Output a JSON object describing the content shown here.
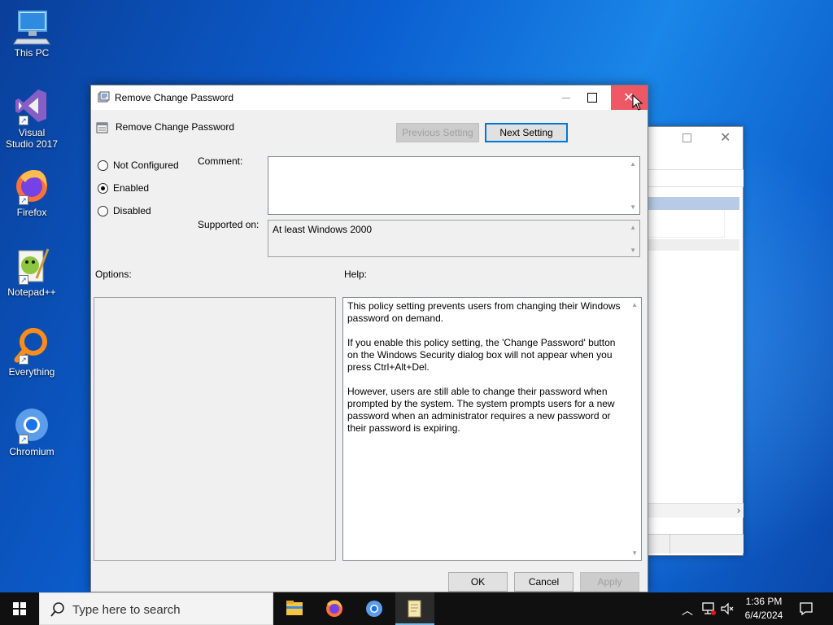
{
  "desktop": {
    "icons": [
      {
        "name": "this-pc",
        "label": "This PC"
      },
      {
        "name": "visual-studio",
        "label": "Visual Studio 2017"
      },
      {
        "name": "firefox",
        "label": "Firefox"
      },
      {
        "name": "notepadpp",
        "label": "Notepad++"
      },
      {
        "name": "everything",
        "label": "Everything"
      },
      {
        "name": "chromium",
        "label": "Chromium"
      }
    ]
  },
  "dialog": {
    "title": "Remove Change Password",
    "header_title": "Remove Change Password",
    "prev_button": "Previous Setting",
    "next_button": "Next Setting",
    "options": [
      {
        "label": "Not Configured",
        "checked": false
      },
      {
        "label": "Enabled",
        "checked": true
      },
      {
        "label": "Disabled",
        "checked": false
      }
    ],
    "comment_label": "Comment:",
    "comment_value": "",
    "supported_label": "Supported on:",
    "supported_value": "At least Windows 2000",
    "options_label": "Options:",
    "help_label": "Help:",
    "help_paragraphs": [
      "This policy setting prevents users from changing their Windows password on demand.",
      "If you enable this policy setting,  the 'Change Password' button on the Windows Security dialog box will not appear when you press Ctrl+Alt+Del.",
      "However, users are still able to change their password when prompted by the system. The system prompts users for a new password when an administrator requires a new password or their password is expiring."
    ],
    "ok_button": "OK",
    "cancel_button": "Cancel",
    "apply_button": "Apply"
  },
  "taskbar": {
    "search_placeholder": "Type here to search",
    "time": "1:36 PM",
    "date": "6/4/2024"
  },
  "colors": {
    "close_hover": "#e81123",
    "desktop_blue": "#0b5fd0",
    "taskbar": "#101010"
  }
}
